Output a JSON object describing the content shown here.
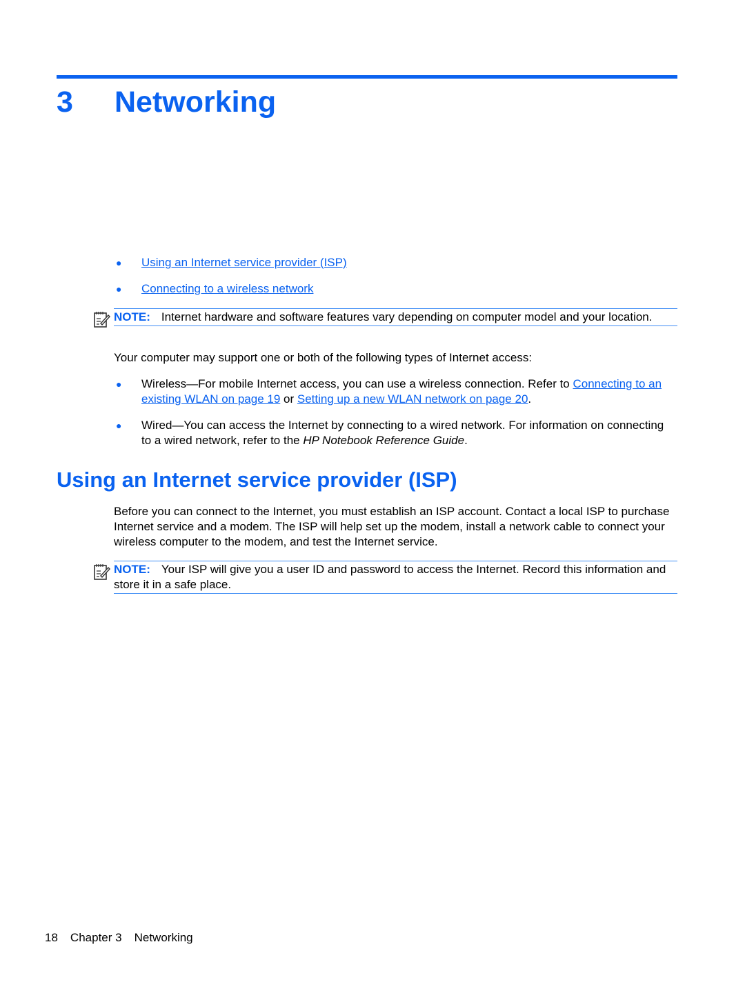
{
  "chapter": {
    "number": "3",
    "title": "Networking"
  },
  "toc": [
    {
      "label": "Using an Internet service provider (ISP)"
    },
    {
      "label": "Connecting to a wireless network"
    }
  ],
  "note1": {
    "label": "NOTE:",
    "text": "Internet hardware and software features vary depending on computer model and your location."
  },
  "intro": "Your computer may support one or both of the following types of Internet access:",
  "access_types": {
    "wireless": {
      "prefix": "Wireless—For mobile Internet access, you can use a wireless connection. Refer to ",
      "link1": "Connecting to an existing WLAN on page 19",
      "middle": " or ",
      "link2": "Setting up a new WLAN network on page 20",
      "suffix": "."
    },
    "wired": {
      "prefix": "Wired—You can access the Internet by connecting to a wired network. For information on connecting to a wired network, refer to the ",
      "italic": "HP Notebook Reference Guide",
      "suffix": "."
    }
  },
  "section": {
    "title": "Using an Internet service provider (ISP)",
    "body": "Before you can connect to the Internet, you must establish an ISP account. Contact a local ISP to purchase Internet service and a modem. The ISP will help set up the modem, install a network cable to connect your wireless computer to the modem, and test the Internet service."
  },
  "note2": {
    "label": "NOTE:",
    "text": "Your ISP will give you a user ID and password to access the Internet. Record this information and store it in a safe place."
  },
  "footer": {
    "page": "18",
    "chapter": "Chapter 3",
    "title": "Networking"
  },
  "colors": {
    "accent": "#0a62f0",
    "rule": "#3d8cf5"
  }
}
